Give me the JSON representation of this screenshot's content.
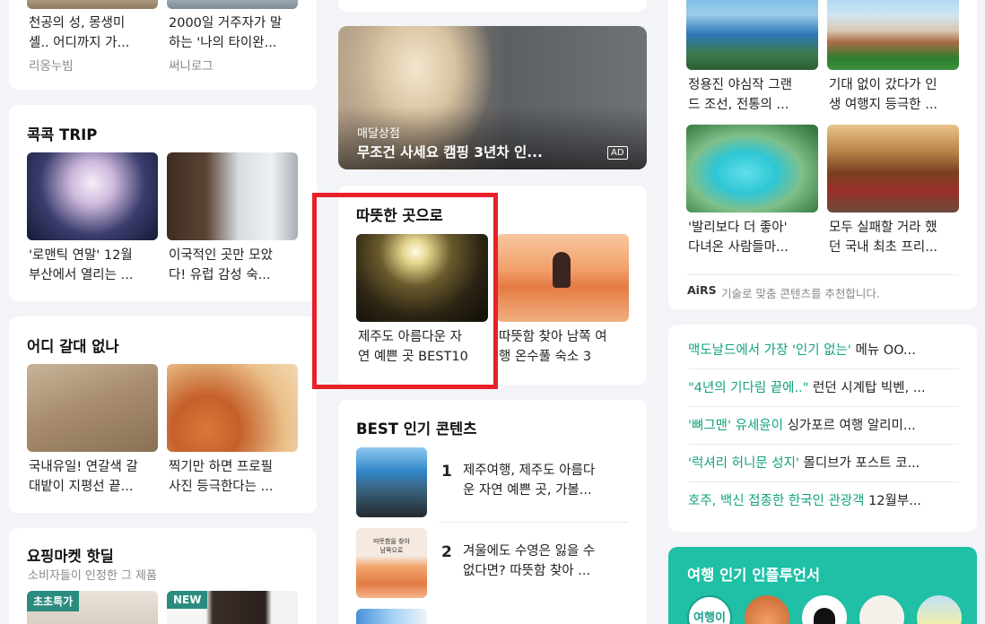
{
  "col1": {
    "top_items": [
      {
        "title1": "천공의 성, 몽생미",
        "title2": "셸.. 어디까지 가...",
        "source": "리옹누빔"
      },
      {
        "title1": "2000일 거주자가 말",
        "title2": "하는 '나의 타이완...",
        "source": "써니로그"
      }
    ],
    "trip": {
      "heading": "콕콕 TRIP",
      "items": [
        {
          "title1": "'로맨틱 연말' 12월",
          "title2": "부산에서 열리는 ..."
        },
        {
          "title1": "이국적인 곳만 모았",
          "title2": "다! 유럽 감성 숙..."
        }
      ]
    },
    "anywhere": {
      "heading": "어디 갈대 없나",
      "items": [
        {
          "title1": "국내유일! 연갈색 갈",
          "title2": "대밭이 지평선 끝..."
        },
        {
          "title1": "찍기만 하면 프로필",
          "title2": "사진 등극한다는 ..."
        }
      ]
    },
    "market": {
      "heading": "요핑마켓 핫딜",
      "sub": "소비자들이 인정한 그 제품",
      "badges": [
        "초초특가",
        "NEW"
      ]
    }
  },
  "col2": {
    "ad": {
      "label": "매달상점",
      "title": "무조건 사세요 캠핑 3년차 인...",
      "ad_badge": "AD"
    },
    "warm": {
      "heading": "따뜻한 곳으로",
      "items": [
        {
          "title1": "제주도 아름다운 자",
          "title2": "연 예쁜 곳 BEST10"
        },
        {
          "title1": "따뜻함 찾아 남쪽 여",
          "title2": "행 온수풀 숙소 3"
        }
      ]
    },
    "best": {
      "heading": "BEST 인기 콘텐츠",
      "items": [
        {
          "rank": "1",
          "title1": "제주여행, 제주도 아름다",
          "title2": "운 자연 예쁜 곳, 가볼..."
        },
        {
          "rank": "2",
          "title1": "겨울에도 수영은 잃을 수",
          "title2": "없다면? 따뜻함 찾아 ...",
          "thumb_text1": "따뜻함을 찾아",
          "thumb_text2": "남쪽으로"
        }
      ]
    }
  },
  "col3": {
    "grid": [
      {
        "title1": "정용진 야심작 그랜",
        "title2": "드 조선, 전통의 ..."
      },
      {
        "title1": "기대 없이 갔다가 인",
        "title2": "생 여행지 등극한 ..."
      },
      {
        "title1": "'발리보다 더 좋아'",
        "title2": "다녀온 사람들마..."
      },
      {
        "title1": "모두 실패할 거라 했",
        "title2": "던 국내 최초 프리..."
      }
    ],
    "airs": {
      "logo": "AiRS",
      "text": "기술로 맞춤 콘텐츠를 추천합니다."
    },
    "news": [
      {
        "highlight": "맥도날드에서 가장 '인기 없는'",
        "rest": " 메뉴 OO..."
      },
      {
        "highlight": "\"4년의 기다림 끝에..\"",
        "rest": " 런던 시계탑 빅벤, ..."
      },
      {
        "highlight": "'뼈그맨' 유세윤이",
        "rest": " 싱가포르 여행 알리미..."
      },
      {
        "highlight": "'럭셔리 허니문 성지'",
        "rest": " 몰디브가 포스트 코..."
      },
      {
        "highlight": "호주, 백신 접종한 한국인 관광객",
        "rest": " 12월부..."
      }
    ],
    "influencer": {
      "heading": "여행 인기 인플루언서",
      "first_avatar_text": "여행이"
    }
  },
  "colors": {
    "accent": "#10a37f",
    "highlight_box": "#e8202a",
    "influencer_bg": "#1fc0a5"
  }
}
